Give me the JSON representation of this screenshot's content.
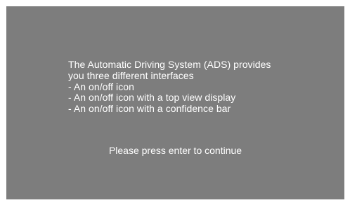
{
  "colors": {
    "screen_background": "#7d7d7d",
    "page_background": "#ffffff",
    "text": "#ffffff"
  },
  "intro": {
    "line1": "The Automatic Driving System (ADS) provides",
    "line2": "you three different interfaces",
    "items": [
      "- An on/off icon",
      "- An on/off icon with a top view display",
      "- An on/off icon with a confidence bar"
    ]
  },
  "prompt": "Please press enter to continue"
}
